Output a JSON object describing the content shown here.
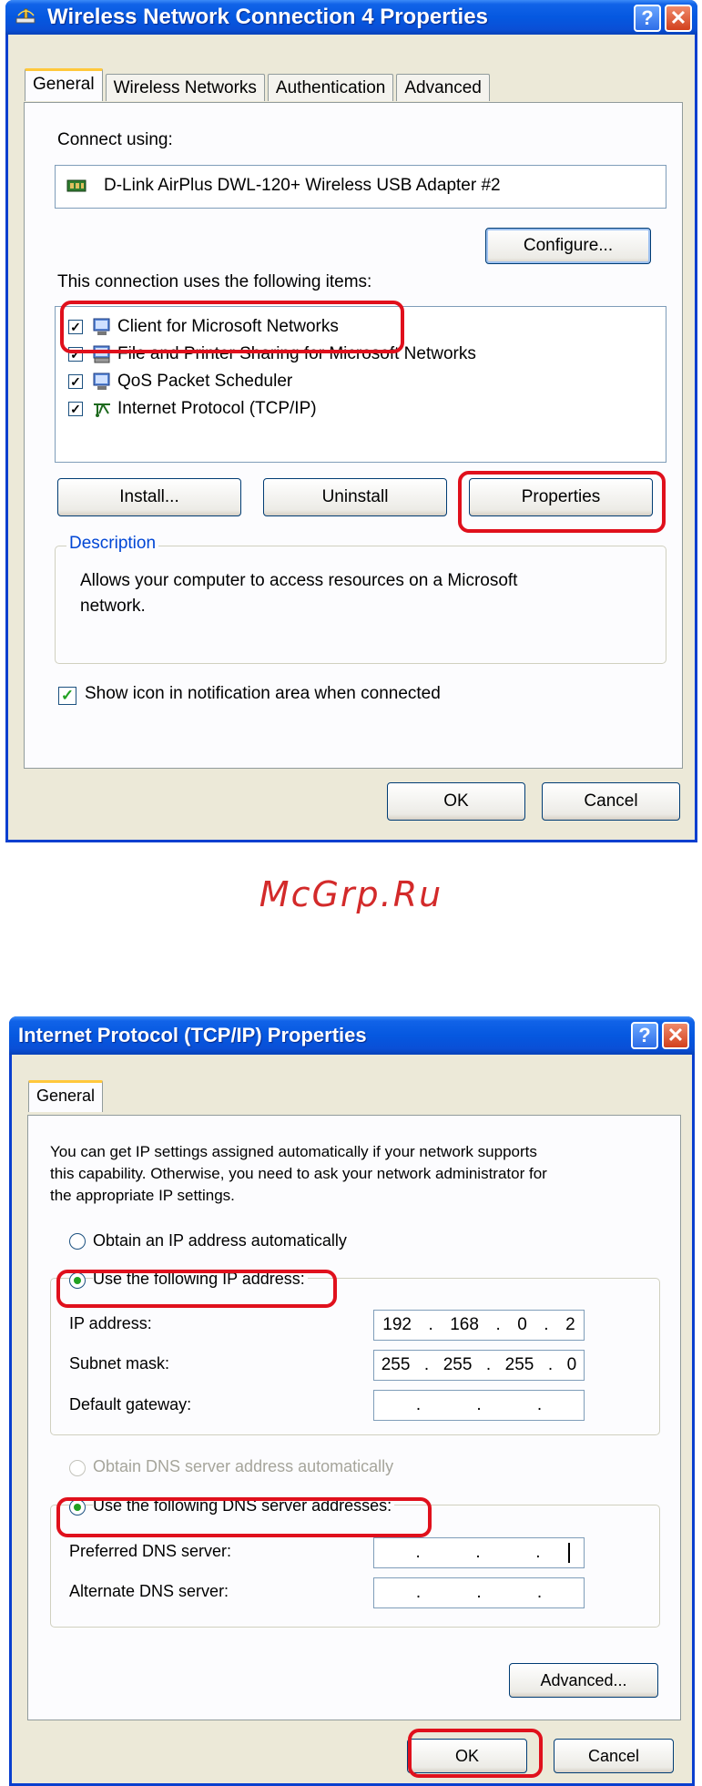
{
  "window1": {
    "title": "Wireless Network Connection 4 Properties",
    "tabs": [
      "General",
      "Wireless Networks",
      "Authentication",
      "Advanced"
    ],
    "connect_using_label": "Connect using:",
    "adapter_name": "D-Link AirPlus DWL-120+ Wireless USB Adapter #2",
    "configure_label": "Configure...",
    "items_label": "This connection uses the following items:",
    "items": [
      {
        "label": "Client for Microsoft Networks",
        "checked": true,
        "icon": "network-client-icon"
      },
      {
        "label": "File and Printer Sharing for Microsoft Networks",
        "checked": true,
        "icon": "file-printer-sharing-icon"
      },
      {
        "label": "QoS Packet Scheduler",
        "checked": true,
        "icon": "qos-scheduler-icon"
      },
      {
        "label": "Internet Protocol (TCP/IP)",
        "checked": true,
        "icon": "protocol-icon"
      }
    ],
    "install_label": "Install...",
    "uninstall_label": "Uninstall",
    "properties_label": "Properties",
    "description_legend": "Description",
    "description_text_1": "Allows your computer to access resources on a Microsoft",
    "description_text_2": "network.",
    "show_icon_label": "Show icon in notification area when connected",
    "ok_label": "OK",
    "cancel_label": "Cancel"
  },
  "watermark": "McGrp.Ru",
  "window2": {
    "title": "Internet Protocol (TCP/IP) Properties",
    "tab": "General",
    "intro_1": "You can get IP settings assigned automatically if your network supports",
    "intro_2": "this capability. Otherwise, you need to ask your network administrator for",
    "intro_3": "the appropriate IP settings.",
    "obtain_ip_label": "Obtain an IP address automatically",
    "use_ip_label": "Use the following IP address:",
    "ip_address_label": "IP address:",
    "ip_address": [
      "192",
      "168",
      "0",
      "2"
    ],
    "subnet_label": "Subnet mask:",
    "subnet": [
      "255",
      "255",
      "255",
      "0"
    ],
    "gateway_label": "Default gateway:",
    "gateway": [
      "",
      "",
      "",
      ""
    ],
    "obtain_dns_label": "Obtain DNS server address automatically",
    "use_dns_label": "Use the following DNS server addresses:",
    "preferred_dns_label": "Preferred DNS server:",
    "preferred_dns": [
      "",
      "",
      "",
      ""
    ],
    "alternate_dns_label": "Alternate DNS server:",
    "alternate_dns": [
      "",
      "",
      "",
      ""
    ],
    "advanced_label": "Advanced...",
    "ok_label": "OK",
    "cancel_label": "Cancel"
  },
  "colors": {
    "titlebar": "#0558e0",
    "highlight": "#e0101c",
    "legend": "#0046d5",
    "dialog_bg": "#ece9d8"
  }
}
